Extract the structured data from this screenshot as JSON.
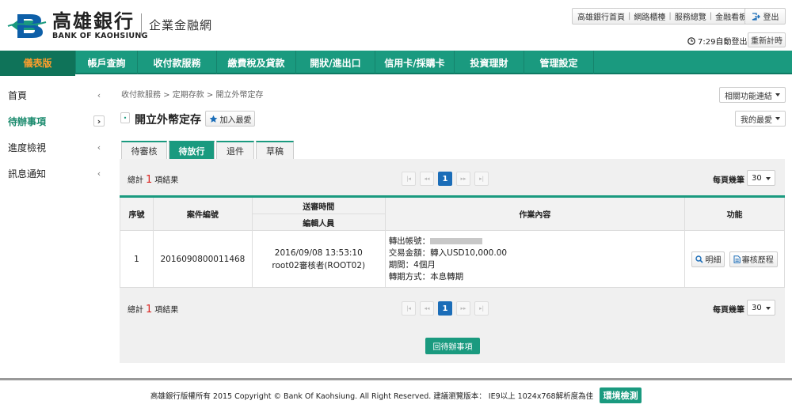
{
  "brand": {
    "name_cn": "高雄銀行",
    "name_en": "BANK OF KAOHSIUNG",
    "subtitle": "企業金融網",
    "color": "#1a9a7f"
  },
  "toplinks": [
    "高雄銀行首頁",
    "網路櫃檯",
    "服務總覽",
    "金融看板"
  ],
  "logout_label": "登出",
  "session": {
    "timer": "7:29自動登出",
    "reset_label": "重新計時"
  },
  "nav": [
    "儀表版",
    "帳戶查詢",
    "收付款服務",
    "繳費稅及貸款",
    "開狀/進出口",
    "信用卡/採購卡",
    "投資理財",
    "管理設定"
  ],
  "sidebar": [
    {
      "label": "首頁",
      "chevron": "‹"
    },
    {
      "label": "待辦事項",
      "chevron": "›"
    },
    {
      "label": "進度檢視",
      "chevron": "‹"
    },
    {
      "label": "訊息通知",
      "chevron": "‹"
    }
  ],
  "breadcrumb": "收付款服務 > 定期存款 > 開立外幣定存",
  "related_label": "相關功能連結",
  "myfav_label": "我的最愛",
  "page_title": "開立外幣定存",
  "add_fav_label": "加入最愛",
  "tabs": [
    "待審核",
    "待放行",
    "退件",
    "草稿"
  ],
  "summary": {
    "prefix": "總計",
    "count": "1",
    "suffix": "項結果"
  },
  "pager": {
    "current": "1",
    "first": "|◂",
    "prev": "◂◂",
    "next": "▸▸",
    "last": "▸|"
  },
  "per_page": {
    "label": "每頁幾筆",
    "value": "30"
  },
  "table": {
    "headers": {
      "seq": "序號",
      "case": "案件編號",
      "sent_time": "送審時間",
      "editor": "編輯人員",
      "content": "作業內容",
      "actions": "功能"
    },
    "rows": [
      {
        "seq": "1",
        "case": "2016090800011468",
        "time": "2016/09/08 13:53:10",
        "editor": "root02審核者(ROOT02)",
        "details": {
          "account_label": "轉出帳號：",
          "amount": "交易金額：轉入USD10,000.00",
          "term": "期間：4個月",
          "method": "轉期方式：本息轉期"
        },
        "btn_detail": "明細",
        "btn_history": "審核歷程"
      }
    ]
  },
  "back_label": "回待辦事項",
  "footer_text": "高雄銀行版權所有 2015 Copyright © Bank Of Kaohsiung. All Right Reserved. 建議瀏覽版本： IE9以上 1024x768解析度為佳",
  "env_check_label": "環境檢測"
}
